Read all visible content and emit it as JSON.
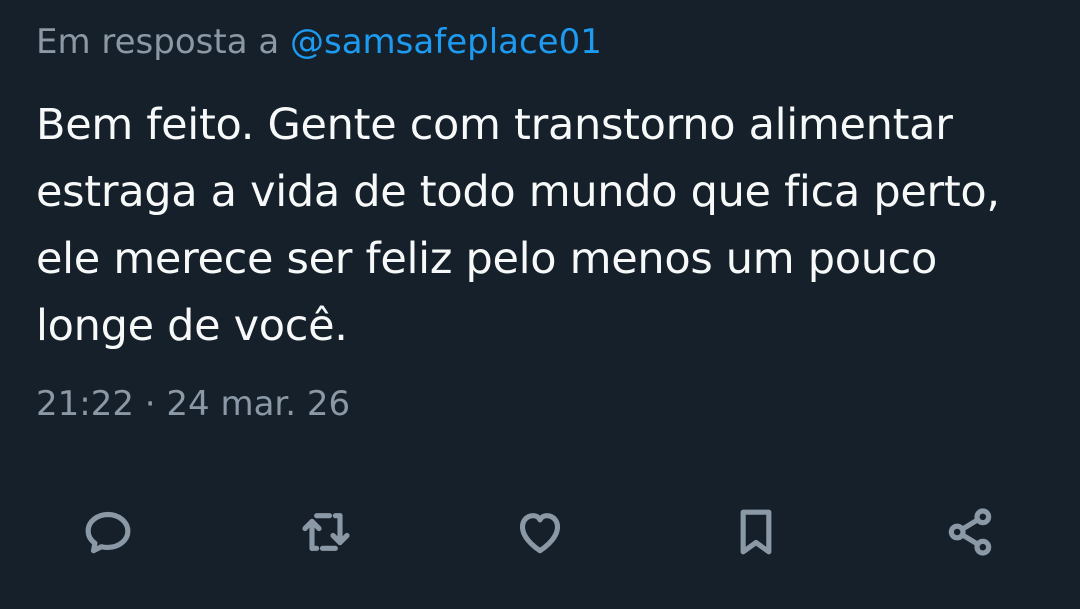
{
  "tweet": {
    "reply_prefix": "Em resposta a ",
    "reply_handle": "@samsafeplace01",
    "text": "Bem feito. Gente com transtorno alimentar estraga a vida de todo mundo que fica perto, ele merece ser feliz pelo menos um pouco longe de você.",
    "timestamp": "21:22 · 24 mar. 26"
  },
  "actions": [
    {
      "name": "reply",
      "icon": "reply-icon"
    },
    {
      "name": "retweet",
      "icon": "retweet-icon"
    },
    {
      "name": "like",
      "icon": "heart-icon"
    },
    {
      "name": "bookmark",
      "icon": "bookmark-icon"
    },
    {
      "name": "share",
      "icon": "share-icon"
    }
  ],
  "colors": {
    "background": "#15202b",
    "text": "#f7f9f9",
    "muted": "#8b98a5",
    "accent": "#1d9bf0"
  }
}
